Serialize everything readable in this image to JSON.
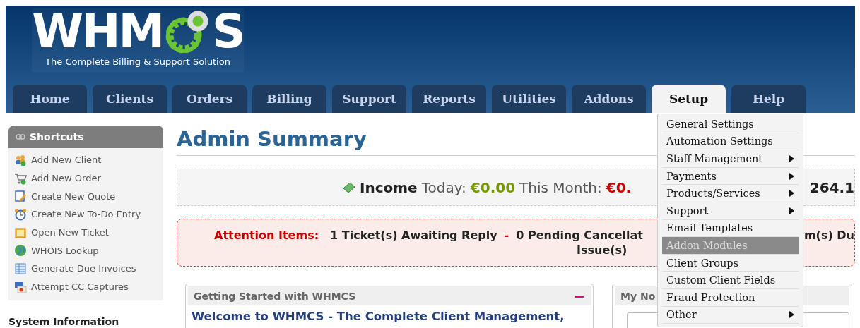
{
  "logo": {
    "wordmark_start": "WHM",
    "wordmark_end": "S",
    "tagline": "The Complete Billing & Support Solution"
  },
  "nav_tabs": [
    {
      "label": "Home",
      "selected": false
    },
    {
      "label": "Clients",
      "selected": false
    },
    {
      "label": "Orders",
      "selected": false
    },
    {
      "label": "Billing",
      "selected": false
    },
    {
      "label": "Support",
      "selected": false
    },
    {
      "label": "Reports",
      "selected": false
    },
    {
      "label": "Utilities",
      "selected": false
    },
    {
      "label": "Addons",
      "selected": false
    },
    {
      "label": "Setup",
      "selected": true
    },
    {
      "label": "Help",
      "selected": false
    }
  ],
  "setup_menu": [
    {
      "label": "General Settings",
      "selected": false,
      "has_submenu": false
    },
    {
      "label": "Automation Settings",
      "selected": false,
      "has_submenu": false
    },
    {
      "label": "Staff Management",
      "selected": false,
      "has_submenu": true
    },
    {
      "label": "Payments",
      "selected": false,
      "has_submenu": true
    },
    {
      "label": "Products/Services",
      "selected": false,
      "has_submenu": true
    },
    {
      "label": "Support",
      "selected": false,
      "has_submenu": true
    },
    {
      "label": "Email Templates",
      "selected": false,
      "has_submenu": false
    },
    {
      "label": "Addon Modules",
      "selected": true,
      "has_submenu": false
    },
    {
      "label": "Client Groups",
      "selected": false,
      "has_submenu": false
    },
    {
      "label": "Custom Client Fields",
      "selected": false,
      "has_submenu": false
    },
    {
      "label": "Fraud Protection",
      "selected": false,
      "has_submenu": false
    },
    {
      "label": "Other",
      "selected": false,
      "has_submenu": true
    }
  ],
  "sidebar": {
    "shortcuts_title": "Shortcuts",
    "shortcuts": [
      {
        "label": "Add New Client"
      },
      {
        "label": "Add New Order"
      },
      {
        "label": "Create New Quote"
      },
      {
        "label": "Create New To-Do Entry"
      },
      {
        "label": "Open New Ticket"
      },
      {
        "label": "WHOIS Lookup"
      },
      {
        "label": "Generate Due Invoices"
      },
      {
        "label": "Attempt CC Captures"
      }
    ],
    "system_info_title": "System Information"
  },
  "main": {
    "title": "Admin Summary",
    "income": {
      "label": "Income",
      "today_label": "Today:",
      "today_value": "€0.00",
      "month_label": "This Month:",
      "month_value": "€0.",
      "trailing": "264.1"
    },
    "attention": {
      "label": "Attention Items:",
      "line_start": "1 Ticket(s) Awaiting Reply",
      "separator": "-",
      "line_cut": "0 Pending Cancellat",
      "line_end": "m(s) Du",
      "second_line": "Issue(s)"
    },
    "panels": [
      {
        "title": "Getting Started with WHMCS",
        "collapse": "−",
        "heading": "Welcome to WHMCS - The Complete Client Management,"
      },
      {
        "title": "My No"
      }
    ]
  }
}
